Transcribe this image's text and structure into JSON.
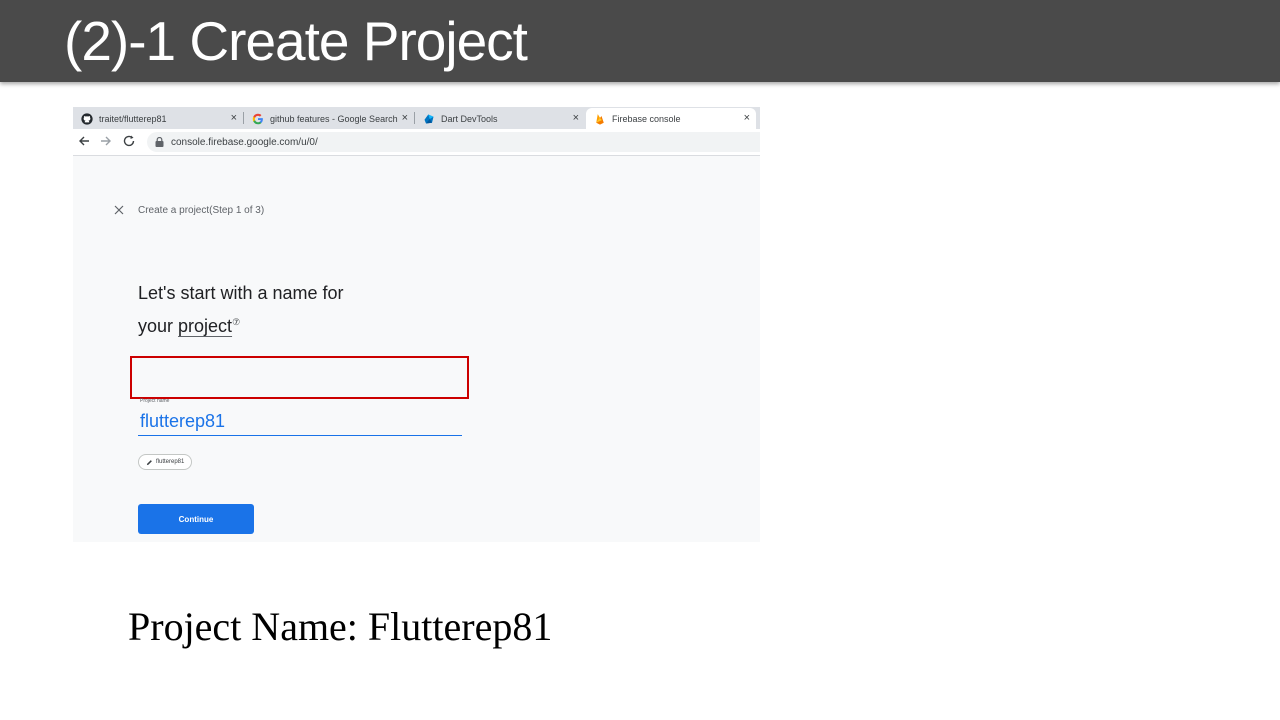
{
  "slide": {
    "title": "(2)-1 Create Project",
    "caption_key": "Project Name:",
    "caption_value": "Flutterep81"
  },
  "browser": {
    "tabs": [
      {
        "label": "traitet/flutterep81",
        "icon": "github-icon",
        "active": false
      },
      {
        "label": "github features - Google Search",
        "icon": "google-icon",
        "active": false
      },
      {
        "label": "Dart DevTools",
        "icon": "dart-devtools-icon",
        "active": false
      },
      {
        "label": "Firebase console",
        "icon": "firebase-icon",
        "active": true
      }
    ],
    "tab_close_glyph": "×",
    "url": "console.firebase.google.com/u/0/"
  },
  "wizard": {
    "close_glyph": "×",
    "step_label": "Create a project(Step 1 of 3)",
    "heading_line1": "Let's start with a name for",
    "heading_line2_prefix": "your ",
    "heading_link": "project",
    "help_glyph": "⑦",
    "field_label": "Project name",
    "field_value": "flutterep81",
    "project_id_chip": "flutterep81",
    "continue_label": "Continue"
  },
  "colors": {
    "header_bg": "#4a4a4a",
    "primary_blue": "#1a73e8",
    "highlight_red": "#cc0000"
  }
}
